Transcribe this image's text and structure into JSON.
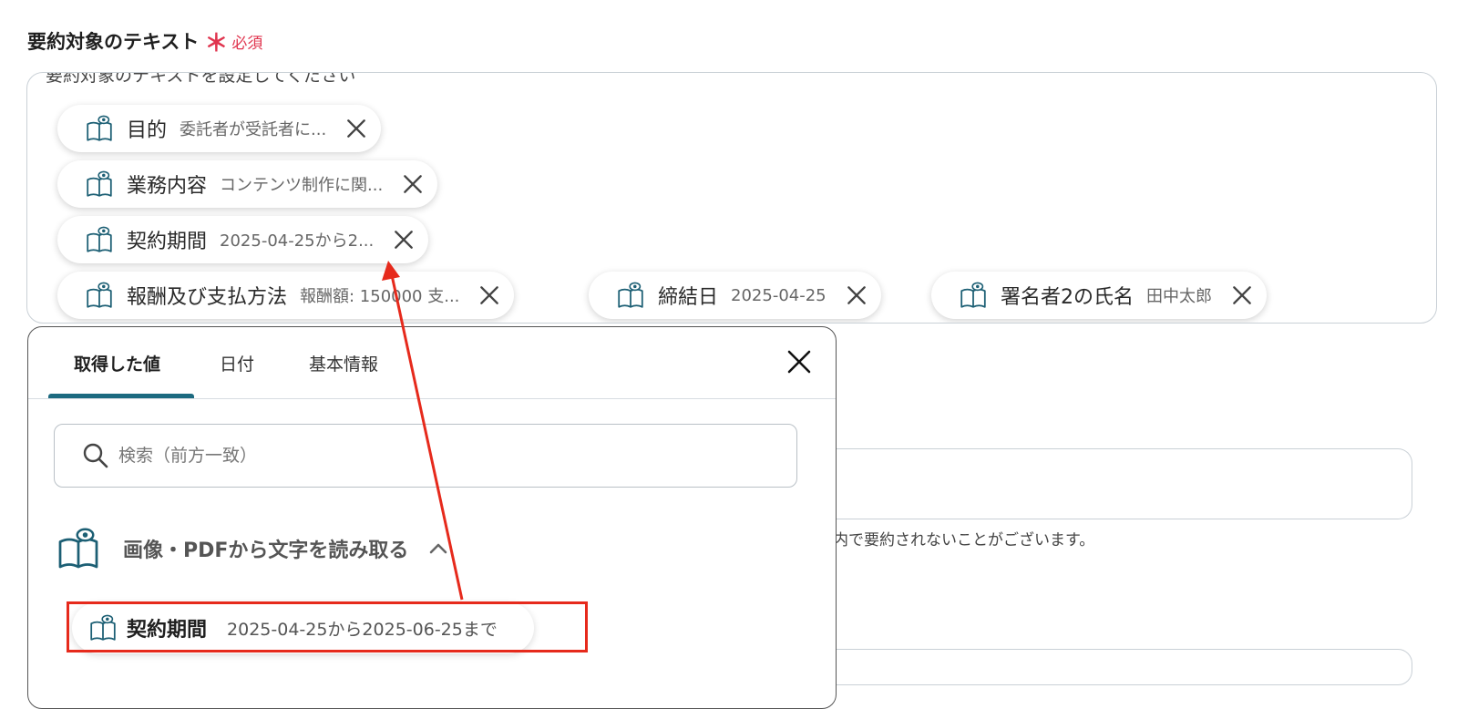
{
  "field": {
    "label": "要約対象のテキスト",
    "required_mark": "＊",
    "required_text": "必須",
    "placeholder": "要約対象のテキストを設定してください"
  },
  "chips": [
    {
      "name": "目的",
      "value": "委託者が受託者に..."
    },
    {
      "name": "業務内容",
      "value": "コンテンツ制作に関..."
    },
    {
      "name": "契約期間",
      "value": "2025-04-25から2..."
    },
    {
      "name": "報酬及び支払方法",
      "value": "報酬額: 150000 支..."
    },
    {
      "name": "締結日",
      "value": "2025-04-25"
    },
    {
      "name": "署名者2の氏名",
      "value": "田中太郎"
    }
  ],
  "popup": {
    "tabs": [
      {
        "label": "取得した値",
        "active": true
      },
      {
        "label": "日付",
        "active": false
      },
      {
        "label": "基本情報",
        "active": false
      }
    ],
    "search_placeholder": "検索（前方一致）",
    "group_title": "画像・PDFから文字を読み取る",
    "item": {
      "name": "契約期間",
      "value": "2025-04-25から2025-06-25まで"
    }
  },
  "background": {
    "note": "数内で要約されないことがございます。"
  },
  "colors": {
    "accent": "#1c6a80",
    "required": "#e0344e",
    "annotation": "#e62a1c"
  },
  "icons": {
    "chip": "book-eye-icon",
    "remove": "close-icon",
    "search": "search-icon",
    "collapse": "chevron-up-icon"
  }
}
